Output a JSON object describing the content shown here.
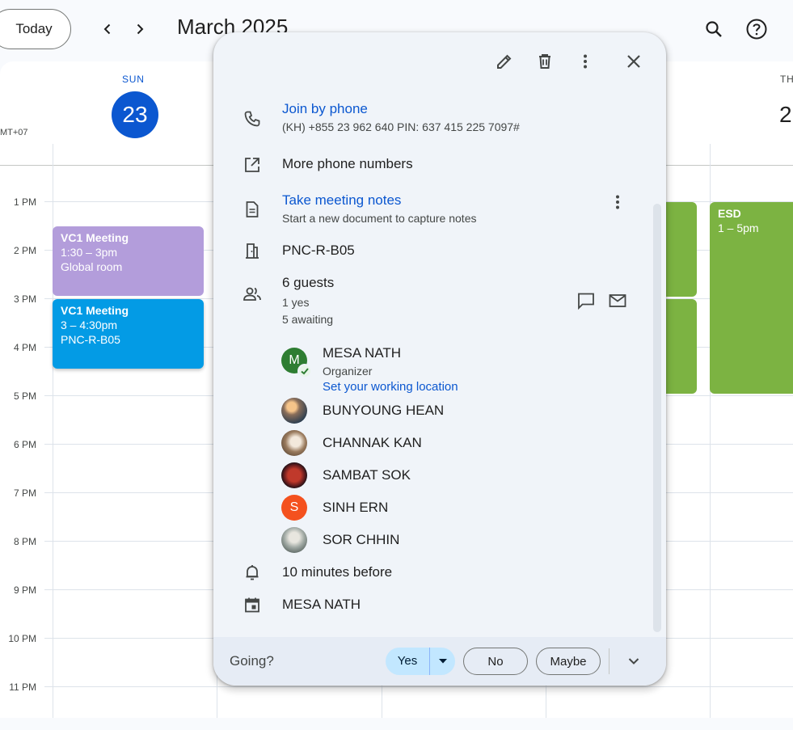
{
  "toolbar": {
    "today_label": "Today",
    "month_title": "March 2025"
  },
  "calendar": {
    "timezone_label": "MT+07",
    "days": [
      {
        "name": "SUN",
        "number": "23"
      },
      {
        "name": "TH",
        "number": "2"
      }
    ],
    "hours": [
      "1 PM",
      "2 PM",
      "3 PM",
      "4 PM",
      "5 PM",
      "6 PM",
      "7 PM",
      "8 PM",
      "9 PM",
      "10 PM",
      "11 PM"
    ],
    "events": [
      {
        "title": "VC1 Meeting",
        "time": "1:30 – 3pm",
        "location": "Global room",
        "color": "#b39ddb"
      },
      {
        "title": "VC1 Meeting",
        "time": "3 – 4:30pm",
        "location": "PNC-R-B05",
        "color": "#039be5"
      },
      {
        "title": "ESD",
        "time": "1 – 5pm",
        "color": "#7cb342"
      }
    ]
  },
  "popup": {
    "join_phone": {
      "label": "Join by phone",
      "detail": "(KH) +855 23 962 640 PIN: 637 415 225 7097#"
    },
    "more_phones": "More phone numbers",
    "notes": {
      "label": "Take meeting notes",
      "detail": "Start a new document to capture notes"
    },
    "room": "PNC-R-B05",
    "guests": {
      "count_label": "6 guests",
      "yes_label": "1 yes",
      "awaiting_label": "5 awaiting",
      "list": [
        {
          "name": "MESA NATH",
          "role": "Organizer",
          "action": "Set your working location",
          "initial": "M",
          "avatar_color": "#2e7d32"
        },
        {
          "name": "BUNYOUNG HEAN"
        },
        {
          "name": "CHANNAK KAN"
        },
        {
          "name": "SAMBAT SOK"
        },
        {
          "name": "SINH ERN",
          "initial": "S",
          "avatar_color": "#f4511e"
        },
        {
          "name": "SOR CHHIN"
        }
      ]
    },
    "reminder": "10 minutes before",
    "calendar_owner": "MESA NATH",
    "footer": {
      "going_label": "Going?",
      "yes": "Yes",
      "no": "No",
      "maybe": "Maybe"
    }
  },
  "colors": {
    "accent": "#0b57d0",
    "today_circle": "#0b57d0"
  }
}
